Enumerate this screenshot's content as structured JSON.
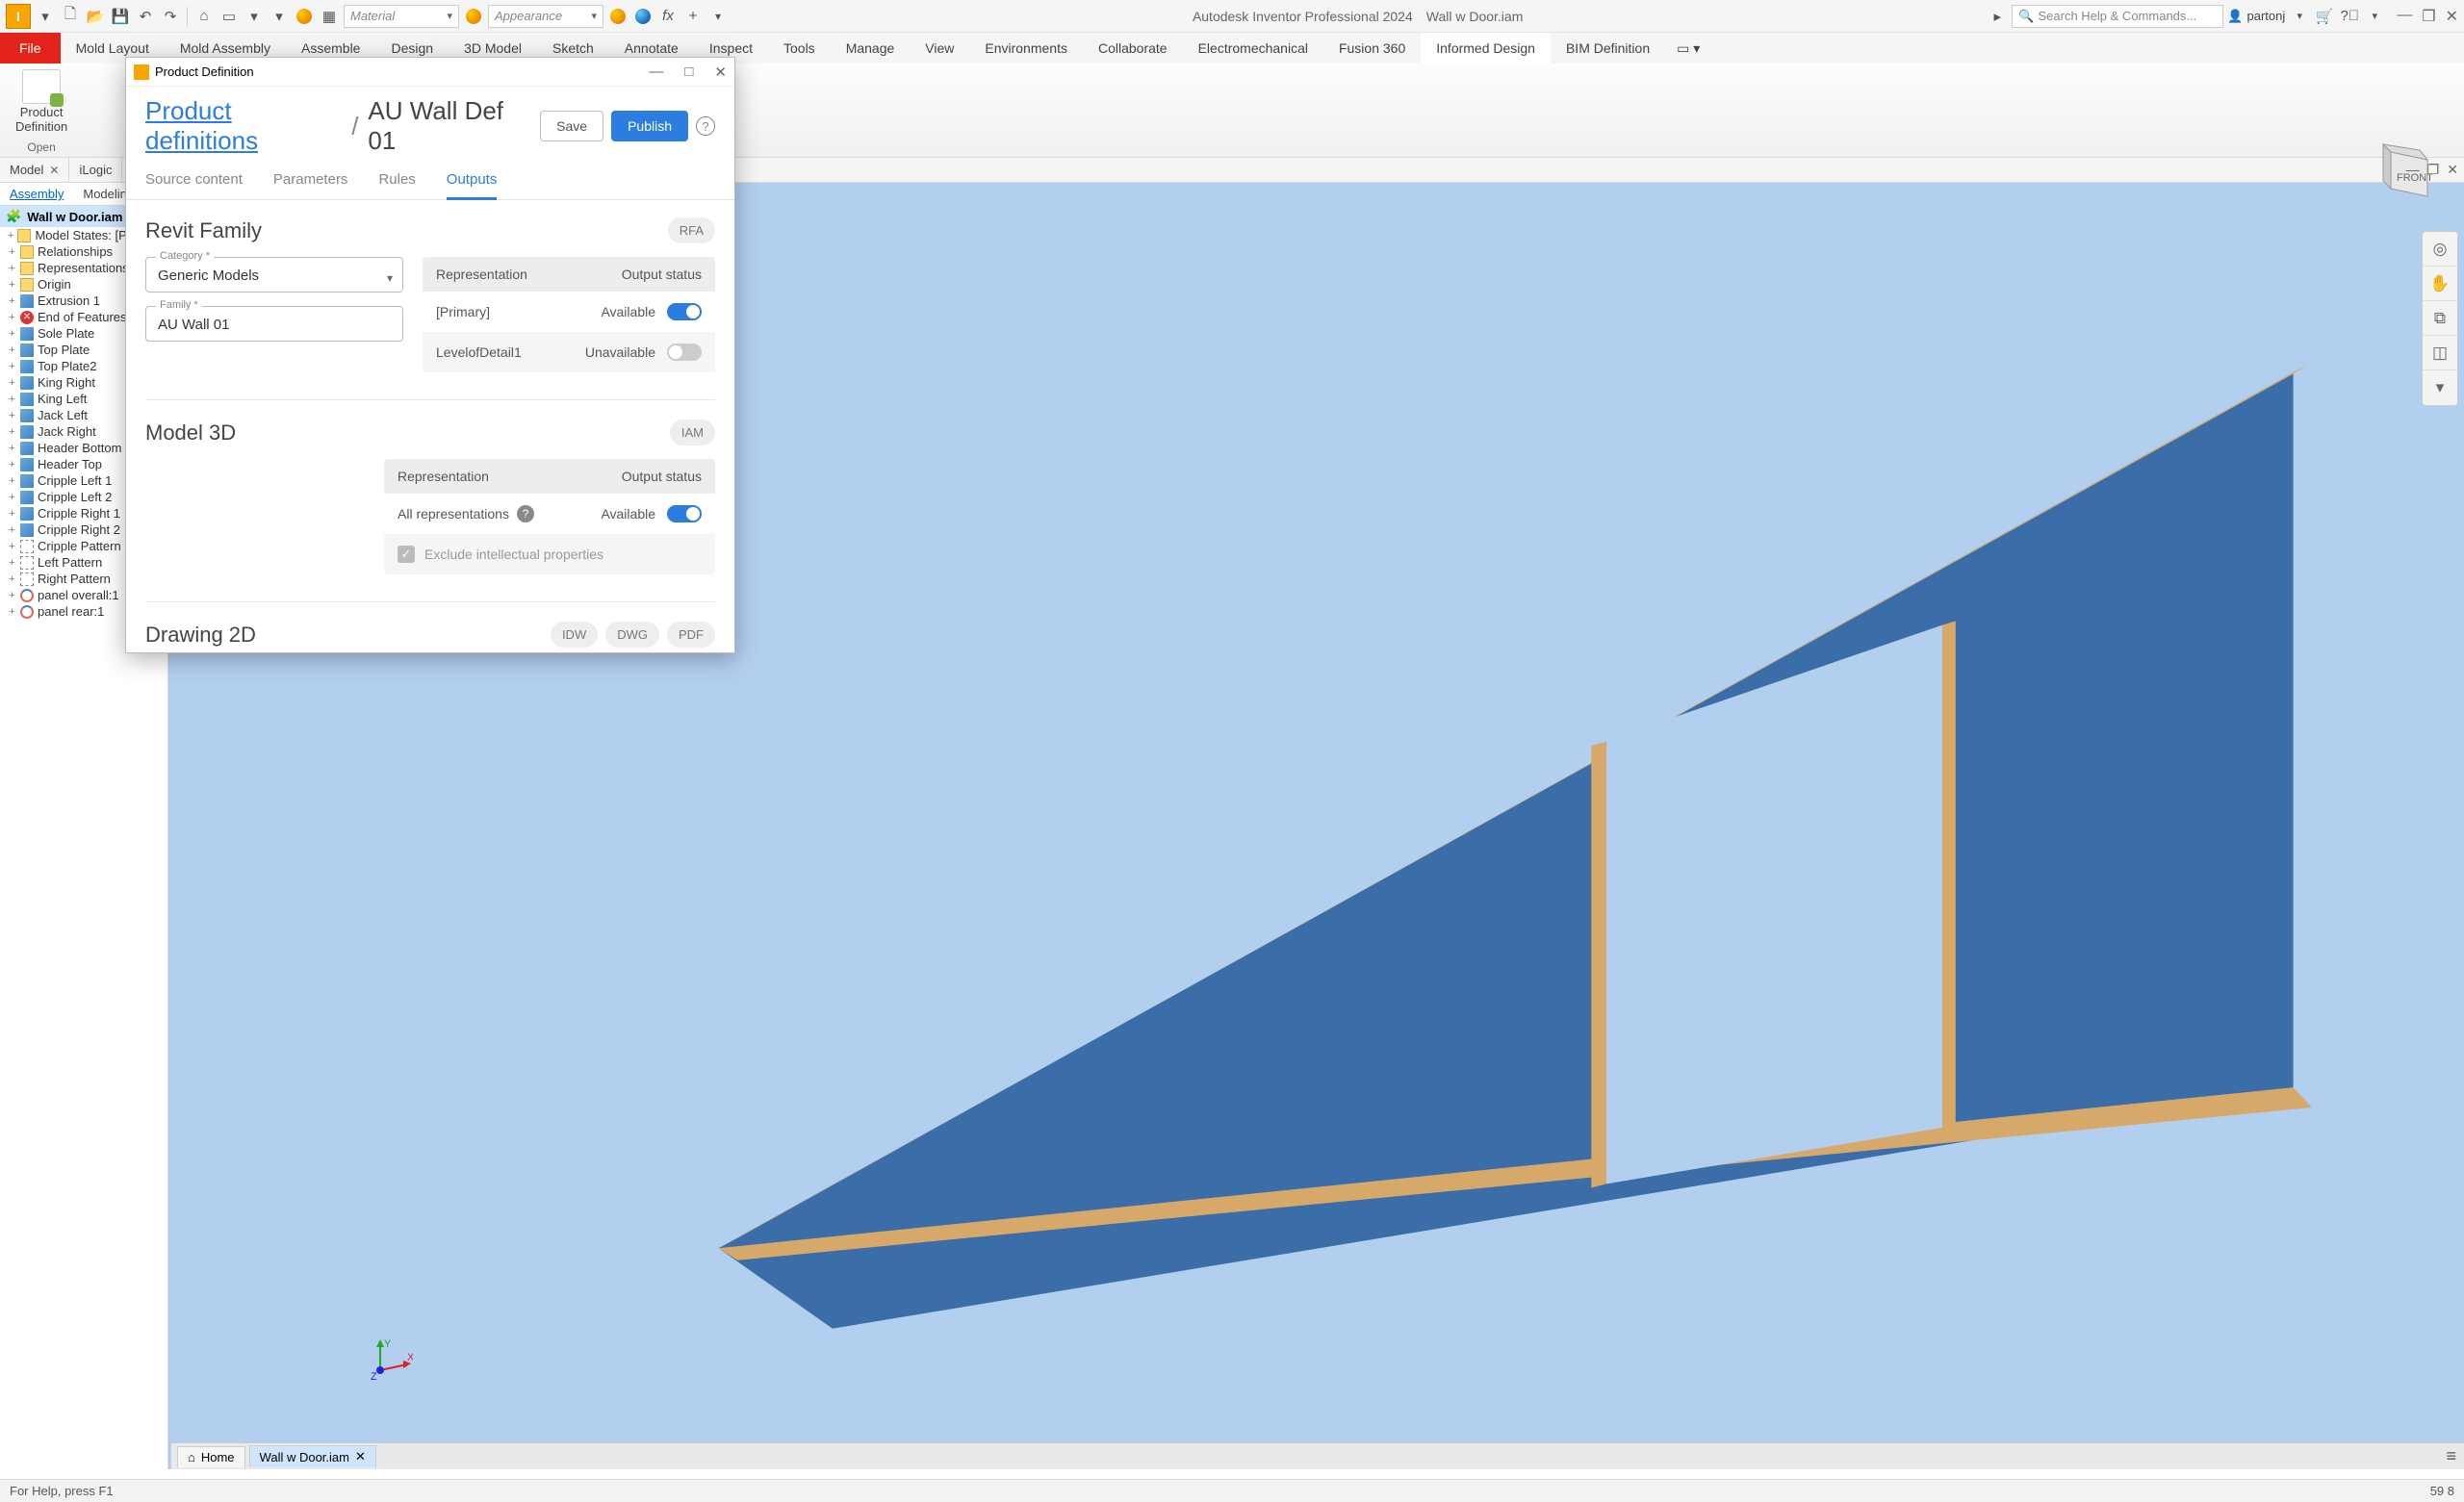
{
  "qat": {
    "material_placeholder": "Material",
    "appearance_placeholder": "Appearance",
    "title_app": "Autodesk Inventor Professional 2024",
    "title_doc": "Wall w Door.iam",
    "search_placeholder": "Search Help & Commands...",
    "user": "partonj"
  },
  "ribbon": {
    "file": "File",
    "tabs": [
      "Mold Layout",
      "Mold Assembly",
      "Assemble",
      "Design",
      "3D Model",
      "Sketch",
      "Annotate",
      "Inspect",
      "Tools",
      "Manage",
      "View",
      "Environments",
      "Collaborate",
      "Electromechanical",
      "Fusion 360",
      "Informed Design",
      "BIM Definition"
    ],
    "active_index": 15,
    "panel_btn_line1": "Product",
    "panel_btn_line2": "Definition",
    "panel_group": "Open"
  },
  "doctabs": {
    "tab1": "Model",
    "tab2": "iLogic"
  },
  "browser": {
    "subtab_assembly": "Assembly",
    "subtab_modeling": "Modeling",
    "root": "Wall w Door.iam",
    "items": [
      {
        "t": "f",
        "label": "Model States: [Primary]"
      },
      {
        "t": "f",
        "label": "Relationships"
      },
      {
        "t": "f",
        "label": "Representations"
      },
      {
        "t": "f",
        "label": "Origin"
      },
      {
        "t": "c",
        "label": "Extrusion 1"
      },
      {
        "t": "x",
        "label": "End of Features"
      },
      {
        "t": "c",
        "label": "Sole Plate"
      },
      {
        "t": "c",
        "label": "Top Plate"
      },
      {
        "t": "c",
        "label": "Top Plate2"
      },
      {
        "t": "c",
        "label": "King Right"
      },
      {
        "t": "c",
        "label": "King Left"
      },
      {
        "t": "c",
        "label": "Jack Left"
      },
      {
        "t": "c",
        "label": "Jack Right"
      },
      {
        "t": "c",
        "label": "Header Bottom"
      },
      {
        "t": "c",
        "label": "Header Top"
      },
      {
        "t": "c",
        "label": "Cripple Left 1"
      },
      {
        "t": "c",
        "label": "Cripple Left 2"
      },
      {
        "t": "c",
        "label": "Cripple Right 1"
      },
      {
        "t": "c",
        "label": "Cripple Right 2"
      },
      {
        "t": "p",
        "label": "Cripple Pattern"
      },
      {
        "t": "p",
        "label": "Left Pattern"
      },
      {
        "t": "p",
        "label": "Right Pattern"
      },
      {
        "t": "y",
        "label": "panel overall:1"
      },
      {
        "t": "y",
        "label": "panel rear:1"
      }
    ]
  },
  "dialog": {
    "window_title": "Product Definition",
    "breadcrumb_link": "Product definitions",
    "breadcrumb_sep": "/",
    "breadcrumb_current": "AU Wall Def 01",
    "save": "Save",
    "publish": "Publish",
    "tabs": [
      "Source content",
      "Parameters",
      "Rules",
      "Outputs"
    ],
    "active_tab": 3,
    "revit": {
      "title": "Revit Family",
      "badge": "RFA",
      "category_label": "Category *",
      "category_value": "Generic Models",
      "family_label": "Family *",
      "family_value": "AU Wall 01",
      "col_rep": "Representation",
      "col_status": "Output status",
      "rows": [
        {
          "rep": "[Primary]",
          "status": "Available",
          "on": true
        },
        {
          "rep": "LevelofDetail1",
          "status": "Unavailable",
          "on": false
        }
      ]
    },
    "model3d": {
      "title": "Model 3D",
      "badge": "IAM",
      "col_rep": "Representation",
      "col_status": "Output status",
      "row_rep": "All representations",
      "row_status": "Available",
      "row_on": true,
      "exclude": "Exclude intellectual properties"
    },
    "drawing": {
      "title": "Drawing 2D",
      "badges": [
        "IDW",
        "DWG",
        "PDF"
      ]
    }
  },
  "bottomtabs": {
    "home": "Home",
    "doc": "Wall w Door.iam"
  },
  "status": {
    "left": "For Help, press F1",
    "right": "59  8"
  },
  "viewcube": {
    "face": "FRONT"
  }
}
